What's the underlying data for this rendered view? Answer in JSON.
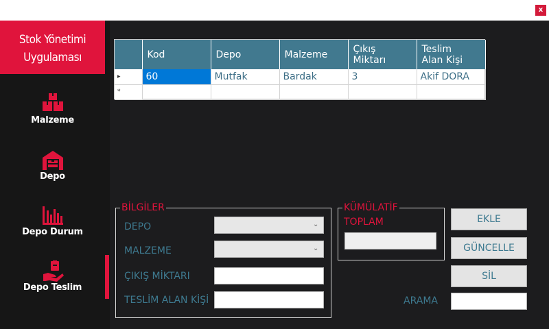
{
  "window": {
    "close_label": "x"
  },
  "brand": {
    "line1": "Stok Yönetimi",
    "line2": "Uygulaması"
  },
  "sidebar": {
    "items": [
      {
        "label": "Malzeme",
        "icon": "boxes-icon"
      },
      {
        "label": "Depo",
        "icon": "warehouse-icon"
      },
      {
        "label": "Depo Durum",
        "icon": "bar-chart-icon"
      },
      {
        "label": "Depo Teslim",
        "icon": "hand-delivery-icon"
      }
    ],
    "active": "Depo Teslim"
  },
  "grid": {
    "columns": [
      "Kod",
      "Depo",
      "Malzeme",
      "Çıkış\nMiktarı",
      "Teslim\nAlan Kişi"
    ],
    "rows": [
      {
        "marker": "▸",
        "cells": [
          "60",
          "Mutfak",
          "Bardak",
          "3",
          "Akif DORA"
        ]
      },
      {
        "marker": "*",
        "cells": [
          "",
          "",
          "",
          "",
          ""
        ]
      }
    ]
  },
  "info_group": {
    "title": "BİLGİLER",
    "depo_label": "DEPO",
    "depo_value": "",
    "malzeme_label": "MALZEME",
    "malzeme_value": "",
    "cikis_label": "ÇIKIŞ MİKTARI",
    "cikis_value": "",
    "teslim_label": "TESLİM ALAN KİŞİ",
    "teslim_value": ""
  },
  "cumulative": {
    "title_line1": "KÜMÜLATİF",
    "title_line2": "TOPLAM",
    "value": ""
  },
  "buttons": {
    "add": "EKLE",
    "update": "GÜNCELLE",
    "delete": "SİL"
  },
  "search": {
    "label": "ARAMA",
    "value": ""
  },
  "colors": {
    "accent": "#e0143c",
    "header": "#41798f",
    "label": "#3e7a90",
    "background": "#1c1c1e"
  }
}
